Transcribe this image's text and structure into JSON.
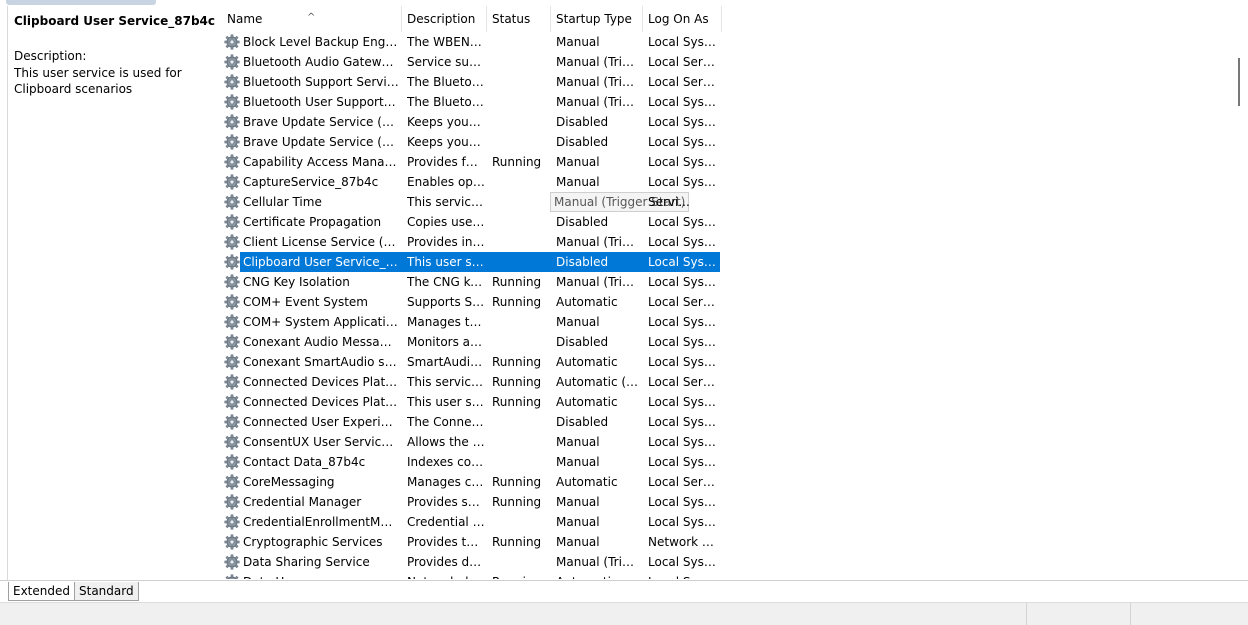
{
  "left_pane": {
    "title": "Clipboard User Service_87b4c",
    "description_label": "Description:",
    "description_text": "This user service is used for Clipboard scenarios"
  },
  "columns": {
    "name": "Name",
    "description": "Description",
    "status": "Status",
    "startup_type": "Startup Type",
    "log_on_as": "Log On As",
    "sort_indicator": "^"
  },
  "services": [
    {
      "name": "Block Level Backup Engine ...",
      "description": "The WBENG...",
      "status": "",
      "startup": "Manual",
      "logon": "Local Syste..."
    },
    {
      "name": "Bluetooth Audio Gateway S...",
      "description": "Service sup...",
      "status": "",
      "startup": "Manual (Trig...",
      "logon": "Local Servi..."
    },
    {
      "name": "Bluetooth Support Service",
      "description": "The Bluetoo...",
      "status": "",
      "startup": "Manual (Trig...",
      "logon": "Local Servi..."
    },
    {
      "name": "Bluetooth User Support Ser...",
      "description": "The Bluetoo...",
      "status": "",
      "startup": "Manual (Trig...",
      "logon": "Local Syste..."
    },
    {
      "name": "Brave Update Service (brave)",
      "description": "Keeps your ...",
      "status": "",
      "startup": "Disabled",
      "logon": "Local Syste..."
    },
    {
      "name": "Brave Update Service (brave...",
      "description": "Keeps your ...",
      "status": "",
      "startup": "Disabled",
      "logon": "Local Syste..."
    },
    {
      "name": "Capability Access Manager ...",
      "description": "Provides fac...",
      "status": "Running",
      "startup": "Manual",
      "logon": "Local Syste..."
    },
    {
      "name": "CaptureService_87b4c",
      "description": "Enables opti...",
      "status": "",
      "startup": "Manual",
      "logon": "Local Syste..."
    },
    {
      "name": "Cellular Time",
      "description": "This service ...",
      "status": "",
      "startup": "Manual (Trigger Start)",
      "logon": "Servi..."
    },
    {
      "name": "Certificate Propagation",
      "description": "Copies user ...",
      "status": "",
      "startup": "Disabled",
      "logon": "Local Syste..."
    },
    {
      "name": "Client License Service (Clip...",
      "description": "Provides inf...",
      "status": "",
      "startup": "Manual (Trig...",
      "logon": "Local Syste..."
    },
    {
      "name": "Clipboard User Service_87b4c",
      "description": "This user ser...",
      "status": "",
      "startup": "Disabled",
      "logon": "Local Syste..."
    },
    {
      "name": "CNG Key Isolation",
      "description": "The CNG ke...",
      "status": "Running",
      "startup": "Manual (Trig...",
      "logon": "Local Syste..."
    },
    {
      "name": "COM+ Event System",
      "description": "Supports Sy...",
      "status": "Running",
      "startup": "Automatic",
      "logon": "Local Servi..."
    },
    {
      "name": "COM+ System Application",
      "description": "Manages th...",
      "status": "",
      "startup": "Manual",
      "logon": "Local Syste..."
    },
    {
      "name": "Conexant Audio Message S...",
      "description": "Monitors au...",
      "status": "",
      "startup": "Disabled",
      "logon": "Local Syste..."
    },
    {
      "name": "Conexant SmartAudio service",
      "description": "SmartAudio...",
      "status": "Running",
      "startup": "Automatic",
      "logon": "Local Syste..."
    },
    {
      "name": "Connected Devices Platfor...",
      "description": "This service ...",
      "status": "Running",
      "startup": "Automatic (D...",
      "logon": "Local Servi..."
    },
    {
      "name": "Connected Devices Platfor...",
      "description": "This user ser...",
      "status": "Running",
      "startup": "Automatic",
      "logon": "Local Syste..."
    },
    {
      "name": "Connected User Experience...",
      "description": "The Connec...",
      "status": "",
      "startup": "Disabled",
      "logon": "Local Syste..."
    },
    {
      "name": "ConsentUX User Service_87...",
      "description": "Allows the s...",
      "status": "",
      "startup": "Manual",
      "logon": "Local Syste..."
    },
    {
      "name": "Contact Data_87b4c",
      "description": "Indexes con...",
      "status": "",
      "startup": "Manual",
      "logon": "Local Syste..."
    },
    {
      "name": "CoreMessaging",
      "description": "Manages co...",
      "status": "Running",
      "startup": "Automatic",
      "logon": "Local Servi..."
    },
    {
      "name": "Credential Manager",
      "description": "Provides se...",
      "status": "Running",
      "startup": "Manual",
      "logon": "Local Syste..."
    },
    {
      "name": "CredentialEnrollmentMana...",
      "description": "Credential E...",
      "status": "",
      "startup": "Manual",
      "logon": "Local Syste..."
    },
    {
      "name": "Cryptographic Services",
      "description": "Provides thr...",
      "status": "Running",
      "startup": "Manual",
      "logon": "Network S..."
    },
    {
      "name": "Data Sharing Service",
      "description": "Provides da...",
      "status": "",
      "startup": "Manual (Trig...",
      "logon": "Local Syste..."
    },
    {
      "name": "Data Usage",
      "description": "Network da...",
      "status": "Running",
      "startup": "Automatic",
      "logon": "Local Servi..."
    }
  ],
  "selected_service": "Clipboard User Service_87b4c",
  "tooltip": "Manual (Trigger Start)",
  "tabs": {
    "extended": "Extended",
    "standard": "Standard"
  },
  "icons": {
    "service": "gear-icon"
  },
  "colors": {
    "selection": "#0078d7"
  }
}
